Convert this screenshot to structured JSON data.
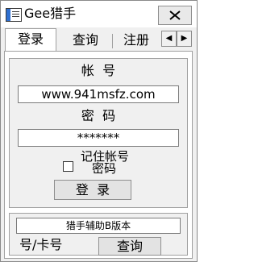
{
  "window": {
    "title": "Gee猎手"
  },
  "tabs": [
    {
      "label": "登录"
    },
    {
      "label": "查询"
    },
    {
      "label": "注册"
    }
  ],
  "tab_scroll": {
    "left": "◀",
    "right": "▶"
  },
  "login": {
    "account_label": "帐  号",
    "account_value": "www.941msfz.com",
    "password_label": "密  码",
    "password_value": "*******",
    "remember_label": "记住帐号",
    "remember_label_line2": "密码",
    "login_button": "登  录"
  },
  "query": {
    "field_value": "猎手辅助B版本",
    "card_label": "号/卡号",
    "query_button": "查询"
  }
}
